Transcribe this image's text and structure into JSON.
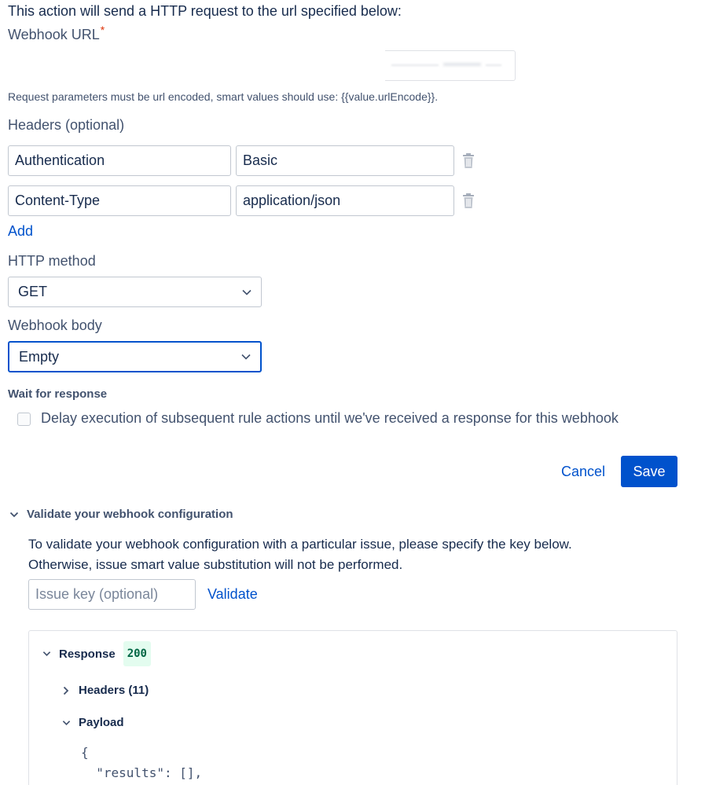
{
  "intro": "This action will send a HTTP request to the url specified below:",
  "webhook_url": {
    "label": "Webhook URL",
    "required_mark": "*",
    "value": ""
  },
  "helper_text": "Request parameters must be url encoded, smart values should use: {{value.urlEncode}}.",
  "headers": {
    "label": "Headers (optional)",
    "rows": [
      {
        "key": "Authentication",
        "value": "Basic"
      },
      {
        "key": "Content-Type",
        "value": "application/json"
      }
    ],
    "add_label": "Add"
  },
  "http_method": {
    "label": "HTTP method",
    "selected": "GET"
  },
  "webhook_body": {
    "label": "Webhook body",
    "selected": "Empty"
  },
  "wait_for_response": {
    "label": "Wait for response",
    "checkbox_label": "Delay execution of subsequent rule actions until we've received a response for this webhook",
    "checked": false
  },
  "actions": {
    "cancel_label": "Cancel",
    "save_label": "Save"
  },
  "validate": {
    "title": "Validate your webhook configuration",
    "description_line1": "To validate your webhook configuration with a particular issue, please specify the key below.",
    "description_line2": "Otherwise, issue smart value substitution will not be performed.",
    "issue_placeholder": "Issue key (optional)",
    "validate_label": "Validate",
    "response": {
      "title": "Response",
      "status": "200",
      "headers_label": "Headers (11)",
      "payload_label": "Payload",
      "payload_line1": "{",
      "payload_line2": "  \"results\": [],"
    }
  },
  "colors": {
    "primary": "#0052cc",
    "text": "#172b4d",
    "subtle": "#42526e",
    "required": "#de350b",
    "success_bg": "#e3fcef",
    "success_text": "#006644"
  }
}
